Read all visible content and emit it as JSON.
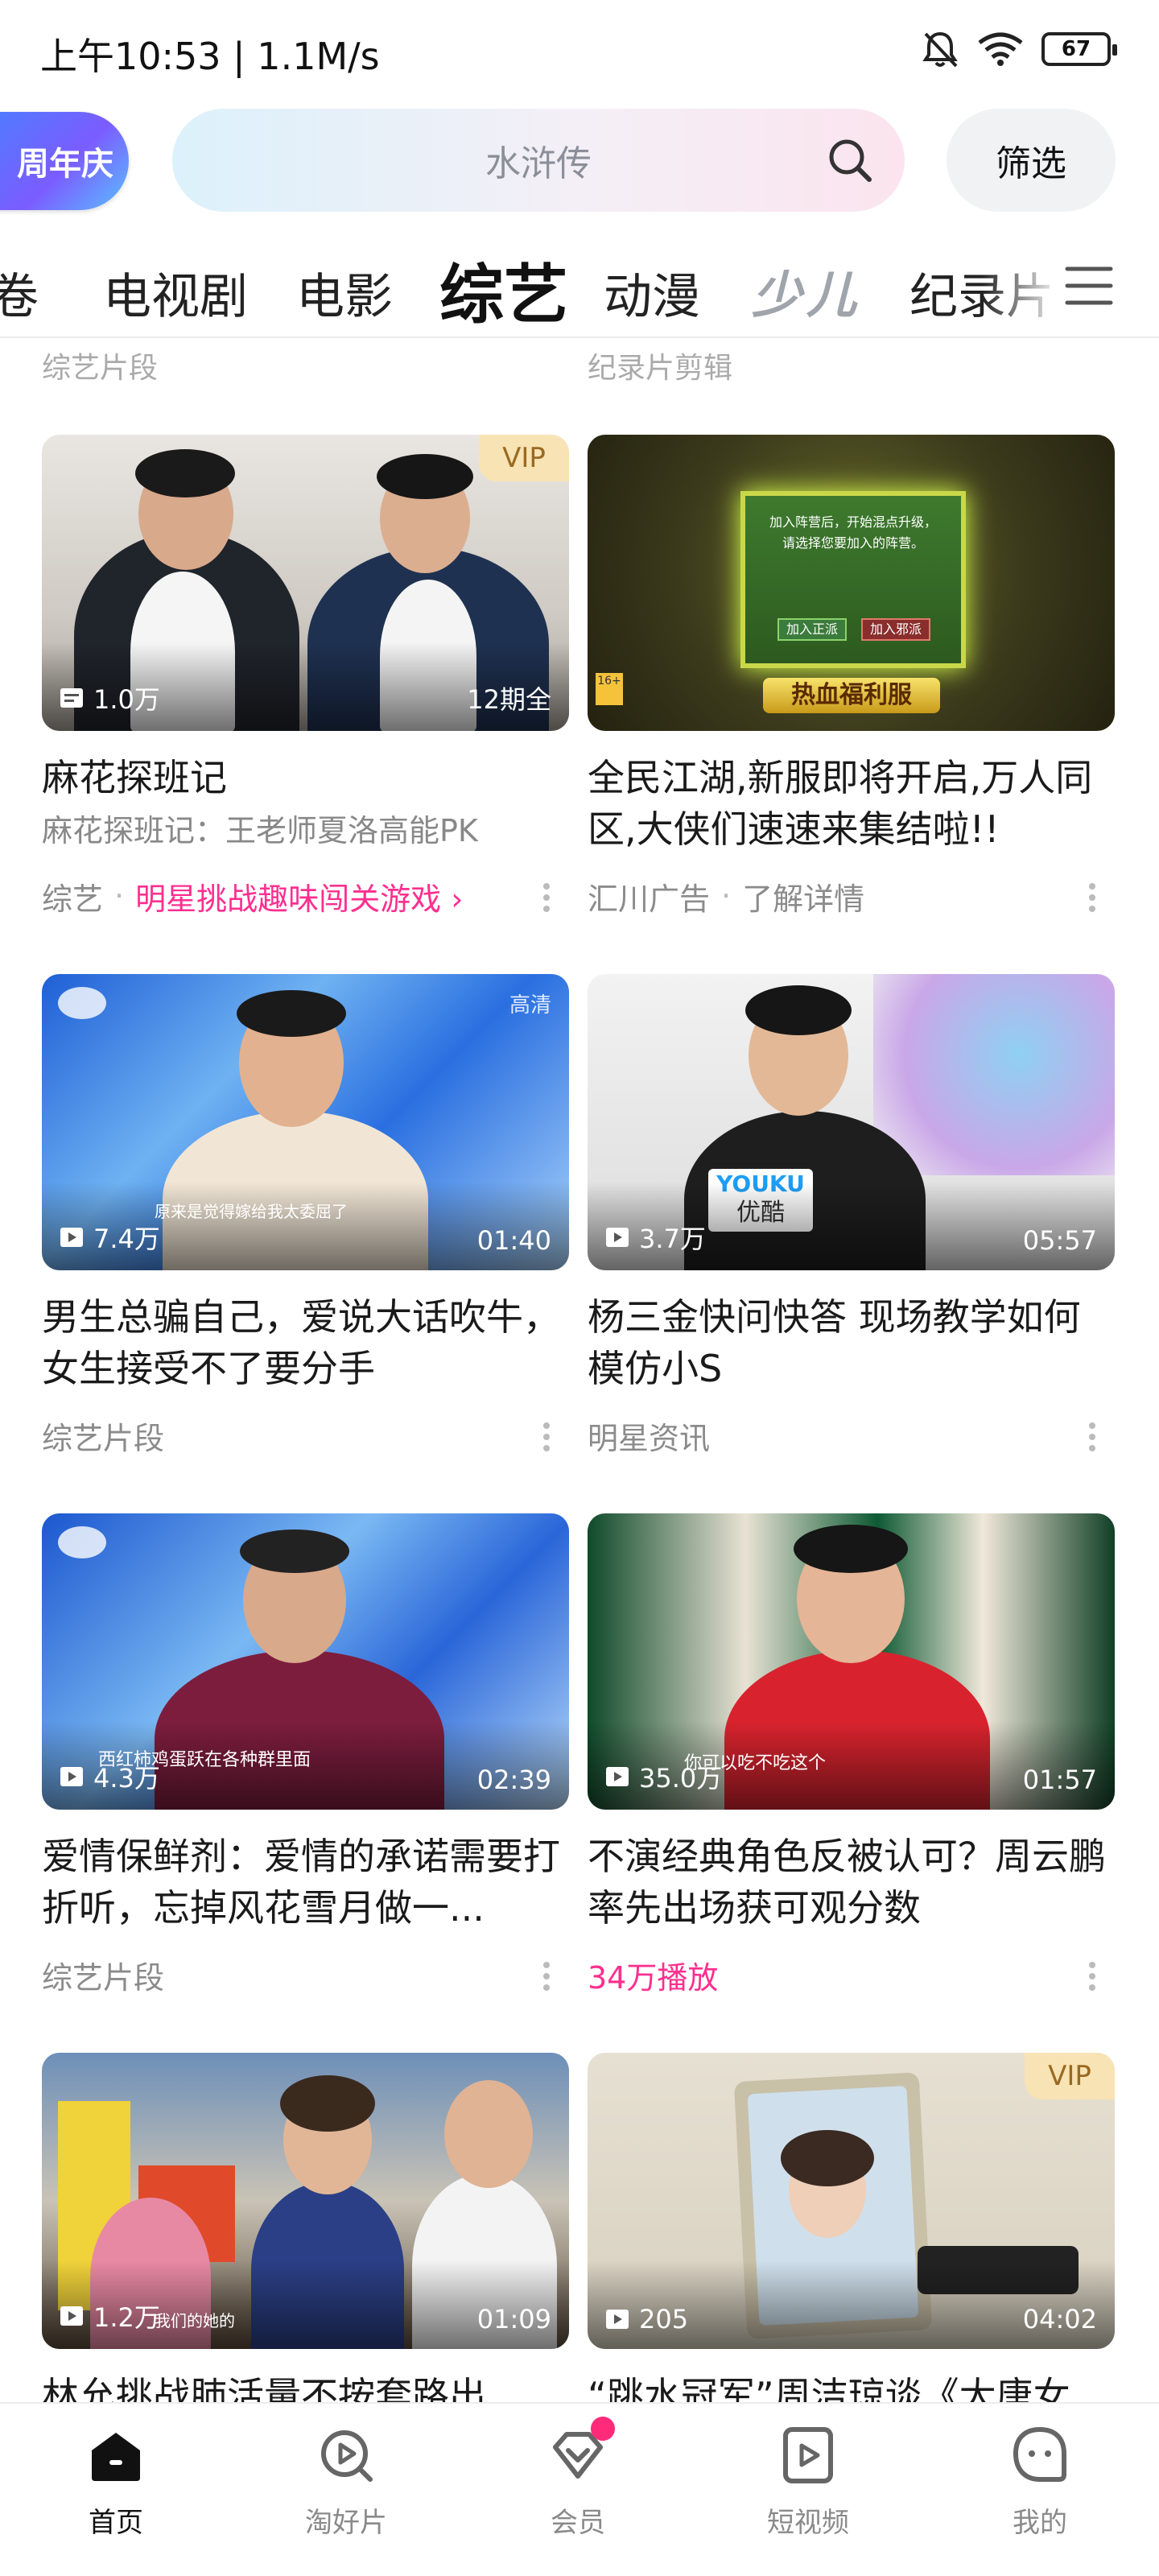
{
  "status_bar": {
    "time_speed": "上午10:53 | 1.1M/s",
    "battery": "67"
  },
  "search_row": {
    "promo_badge": "周年庆",
    "search_placeholder": "水浒传",
    "filter_label": "筛选"
  },
  "tabs": {
    "items": [
      "卷",
      "电视剧",
      "电影",
      "综艺",
      "动漫",
      "少儿",
      "纪录片"
    ],
    "active": "综艺"
  },
  "partial_top": {
    "left_meta": "综艺片段",
    "right_meta": "纪录片剪辑"
  },
  "cards": [
    {
      "title": "麻花探班记",
      "subtitle": "麻花探班记：王老师夏洛高能PK",
      "meta_category": "综艺",
      "meta_link": "明星挑战趣味闯关游戏 ›",
      "views": "1.0万",
      "duration": "12期全",
      "tag": "VIP"
    },
    {
      "title": "全民江湖,新服即将开启,万人同区,大侠们速速来集结啦!!",
      "meta_category": "汇川广告",
      "meta_link": "了解详情",
      "ad_dialog_text": "加入阵营后，开始混点升级，请选择您要加入的阵营。",
      "ad_button_1": "加入正派",
      "ad_button_2": "加入邪派",
      "ad_banner": "热血福利服",
      "age_label": "16+"
    },
    {
      "title": "男生总骗自己，爱说大话吹牛，女生接受不了要分手",
      "meta_category": "综艺片段",
      "views": "7.4万",
      "duration": "01:40",
      "tag": "高清",
      "caption": "原来是觉得嫁给我太委屈了"
    },
    {
      "title": "杨三金快问快答 现场教学如何模仿小S",
      "meta_category": "明星资讯",
      "views": "3.7万",
      "duration": "05:57",
      "youku_en": "YOUKU",
      "youku_cn": "优酷"
    },
    {
      "title": "爱情保鲜剂：爱情的承诺需要打折听，忘掉风花雪月做一...",
      "meta_category": "综艺片段",
      "views": "4.3万",
      "duration": "02:39",
      "caption": "西红柿鸡蛋跃在各种群里面"
    },
    {
      "title": "不演经典角色反被认可？周云鹏率先出场获可观分数",
      "meta_play": "34万播放",
      "views": "35.0万",
      "duration": "01:57",
      "caption": "你可以吃不吃这个"
    },
    {
      "title": "林允挑战肺活量不按套路出",
      "views": "1.2万",
      "duration": "01:09",
      "caption": "我们的她的"
    },
    {
      "title": "“跳水冠军”周洁琼谈《大唐女",
      "views": "205",
      "duration": "04:02",
      "tag": "VIP"
    }
  ],
  "bottom_nav": [
    {
      "label": "首页",
      "icon": "home-icon",
      "active": true
    },
    {
      "label": "淘好片",
      "icon": "discover-icon",
      "active": false
    },
    {
      "label": "会员",
      "icon": "vip-diamond-icon",
      "active": false
    },
    {
      "label": "短视频",
      "icon": "short-video-icon",
      "active": false
    },
    {
      "label": "我的",
      "icon": "profile-icon",
      "active": false
    }
  ],
  "colors": {
    "accent_pink": "#ff2f8f",
    "vip_bg": "#f8e3b4",
    "vip_text": "#9a6a22"
  }
}
